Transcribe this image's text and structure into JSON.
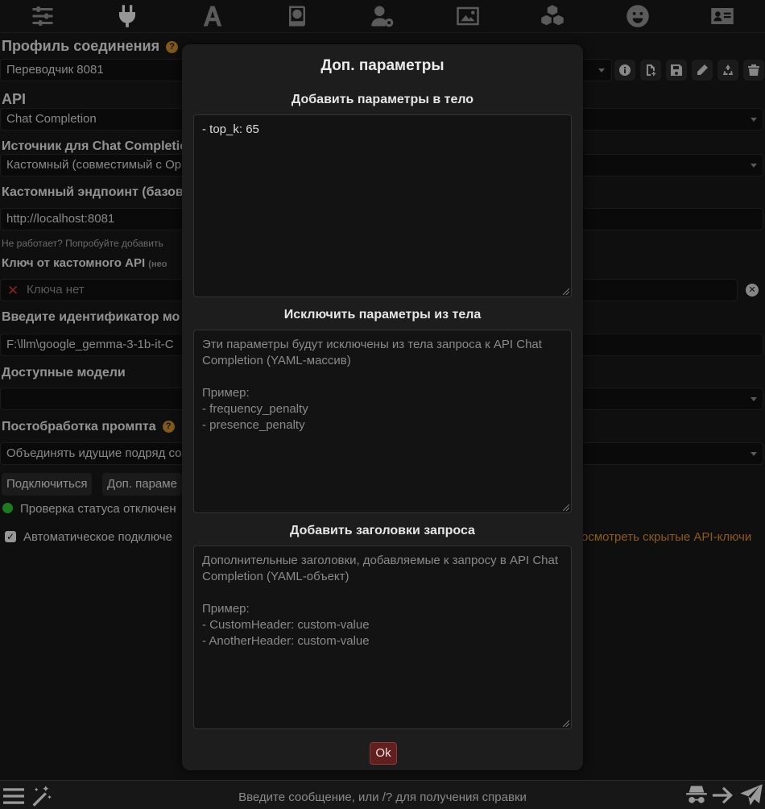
{
  "topbar": {
    "icons": [
      "sliders-icon",
      "plug-icon",
      "font-icon",
      "book-globe-icon",
      "user-gear-icon",
      "image-icon",
      "cubes-icon",
      "smiley-icon",
      "id-card-icon"
    ],
    "active": "plug-icon"
  },
  "profile": {
    "label": "Профиль соединения",
    "help": "?",
    "value": "Переводчик 8081"
  },
  "api": {
    "label": "API",
    "value": "Chat Completion"
  },
  "source": {
    "label": "Источник для Chat Completic",
    "value": "Кастомный (совместимый с Op"
  },
  "endpoint": {
    "label": "Кастомный эндпоинт (базов",
    "value": "http://localhost:8081",
    "hint": "Не работает? Попробуйте добавить"
  },
  "apikey": {
    "label": "Ключ от кастомного API",
    "label_note": "(нео",
    "placeholder": "Ключа нет"
  },
  "model_id": {
    "label": "Введите идентификатор мо",
    "value": "F:\\llm\\google_gemma-3-1b-it-C"
  },
  "models": {
    "label": "Доступные модели",
    "value": ""
  },
  "postproc": {
    "label": "Постобработка промпта",
    "help": "?",
    "value": "Объединять идущие подряд со"
  },
  "buttons": {
    "connect": "Подключиться",
    "extra": "Доп. параме"
  },
  "status": {
    "text": "Проверка статуса отключен",
    "color": "#2bbd2b"
  },
  "autoconnect": {
    "label": "Автоматическое подключе",
    "checked": true,
    "link": "осмотреть скрытые API-ключи"
  },
  "modal": {
    "title": "Доп. параметры",
    "body_add": {
      "label": "Добавить параметры в тело",
      "value": "- top_k: 65"
    },
    "body_exclude": {
      "label": "Исключить параметры из тела",
      "placeholder": "Эти параметры будут исключены из тела запроса к API Chat Completion (YAML-массив)\n\nПример:\n- frequency_penalty\n- presence_penalty"
    },
    "headers": {
      "label": "Добавить заголовки запроса",
      "placeholder": "Дополнительные заголовки, добавляемые к запросу в API Chat Completion (YAML-объект)\n\nПример:\n- CustomHeader: custom-value\n- AnotherHeader: custom-value"
    },
    "ok": "Ok"
  },
  "chat": {
    "placeholder": "Введите сообщение, или /? для получения справки"
  },
  "colors": {
    "accent": "#c7892f",
    "ok_button": "#611f1f",
    "link": "#d98a2b"
  }
}
